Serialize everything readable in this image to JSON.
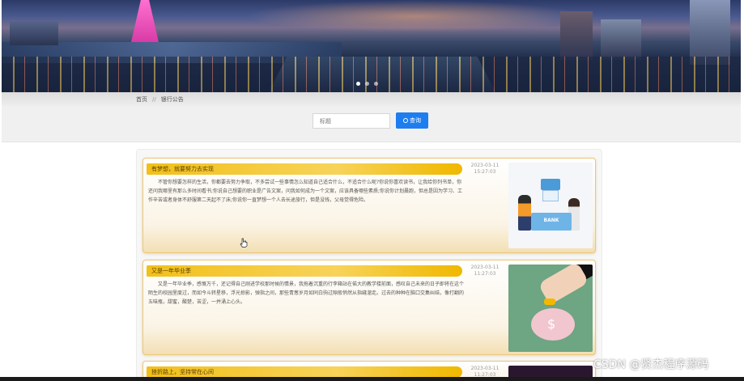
{
  "breadcrumb": {
    "home": "首页",
    "separator": "//",
    "current": "银行公告"
  },
  "search": {
    "placeholder": "标题",
    "button_label": "查询"
  },
  "notices": [
    {
      "title": "有梦想，就要努力去实现",
      "date": "2023-03-11",
      "time": "15:27:03",
      "body": "不管你想要怎样的生活，你都要去努力争取，不多尝试一些事情怎么知道自己适合什么，不适合什么呢?你说你喜欢读书，让我给你列书单，你还问我哪里有那么多时间看书;你说自己想要的职业是广告文案，问我如何成为一个文案，应该具备哪些素质;你说你计划晨跑，但总是因为学习、工作辛苦或者身体不舒服第二天起不了床;你说你一直梦想一个人去长途旅行，但是没钱，父母觉得危险。",
      "image_caption": "BANK"
    },
    {
      "title": "又是一年毕业季",
      "date": "2023-03-11",
      "time": "11:27:03",
      "body": "又是一年毕业季，感慨万千，还记得自己刚进学校那时候的情景，我拖着沉重的行李箱站在偌大的教学楼前面，感叹自己未来的日子即将在这个陌生的校园里度过，而如今斗转星移，浮光掠影，弹指之间，那些青葱岁月如同白驹过隙般悄然从指缝溜走。过去的种种在脑口交集纠结，像打翻的五味瓶，甜蜜，酸楚，苦涩，一并涌上心头。",
      "image_caption": "$"
    },
    {
      "title": "挫折路上，坚持常在心间",
      "date": "2023-03-11",
      "time": "11:27:03"
    }
  ],
  "watermark": "CSDN @贤杰程序源码",
  "colors": {
    "primary_button": "#1e7ef0",
    "title_bar": "#f2c01a",
    "card_border": "#e9c77b"
  }
}
